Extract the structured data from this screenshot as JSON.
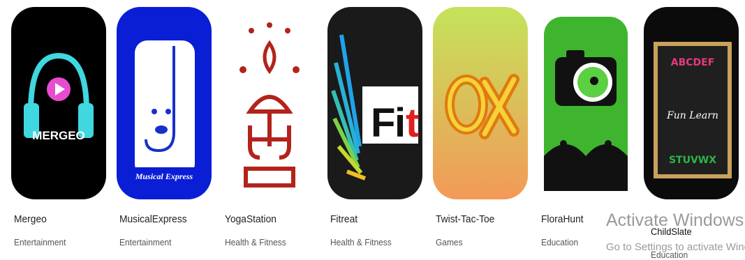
{
  "apps": [
    {
      "name": "Mergeo",
      "category": "Entertainment",
      "icon": "headphones-play-icon",
      "icon_text": "MERGEO"
    },
    {
      "name": "MusicalExpress",
      "category": "Entertainment",
      "icon": "music-note-face-icon",
      "icon_text": "Musical Express"
    },
    {
      "name": "YogaStation",
      "category": "Health & Fitness",
      "icon": "yoga-pose-icon"
    },
    {
      "name": "Fitreat",
      "category": "Health & Fitness",
      "icon": "fit-wing-icon",
      "icon_text": "Fit"
    },
    {
      "name": "Twist-Tac-Toe",
      "category": "Games",
      "icon": "o-x-icon"
    },
    {
      "name": "FloraHunt",
      "category": "Education",
      "icon": "camera-flower-icon"
    },
    {
      "name": "ChildSlate",
      "category": "Education",
      "icon": "chalkboard-icon",
      "icon_text": "Fun Learn"
    }
  ],
  "watermark": {
    "title": "Activate Windows",
    "subtitle": "Go to Settings to activate Windows."
  }
}
